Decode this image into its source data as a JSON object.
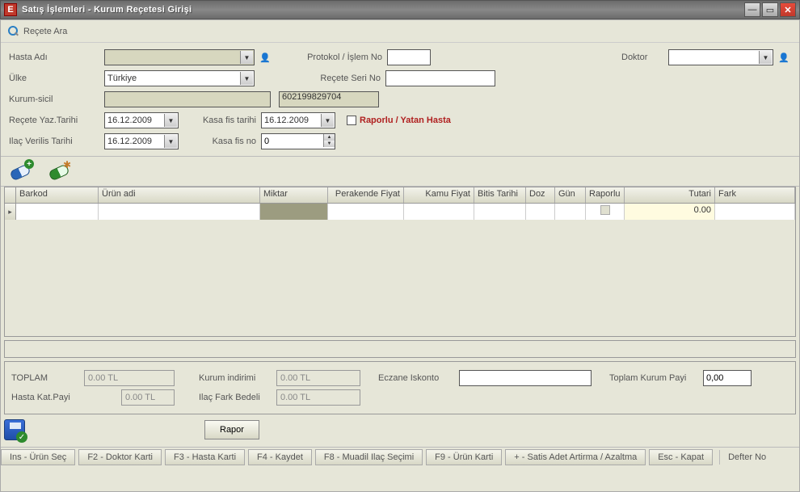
{
  "window": {
    "app_icon_letter": "E",
    "title": "Satış İşlemleri  -  Kurum Reçetesi Girişi"
  },
  "toolbar": {
    "search_label": "Reçete Ara"
  },
  "labels": {
    "hasta_adi": "Hasta Adı",
    "ulke": "Ülke",
    "kurum_sicil": "Kurum-sicil",
    "recete_yaz_tarihi": "Reçete Yaz.Tarihi",
    "ilac_verilis_tarihi": "Ilaç Verilis Tarihi",
    "kasa_fis_tarihi": "Kasa fis tarihi",
    "kasa_fis_no": "Kasa fis no",
    "protokol_islem_no": "Protokol / İşlem No",
    "recete_seri_no": "Reçete Seri No",
    "doktor": "Doktor",
    "raporlu_yatan": "Raporlu / Yatan Hasta"
  },
  "form": {
    "hasta_adi": "",
    "ulke": "Türkiye",
    "kurum_sicil_1": "",
    "kurum_sicil_2": "602199829704",
    "recete_yaz_tarihi": "16.12.2009",
    "kasa_fis_tarihi": "16.12.2009",
    "ilac_verilis_tarihi": "16.12.2009",
    "kasa_fis_no": "0",
    "protokol_islem_no": "",
    "recete_seri_no": "",
    "doktor": ""
  },
  "table": {
    "headers": [
      "Barkod",
      "Ürün adi",
      "Miktar",
      "Perakende Fiyat",
      "Kamu Fiyat",
      "Bitis Tarihi",
      "Doz",
      "Gün",
      "Raporlu",
      "Tutari",
      "Fark"
    ],
    "row": {
      "tutari": "0.00"
    }
  },
  "totals": {
    "toplam_label": "TOPLAM",
    "toplam_value": "0.00 TL",
    "kurum_indirimi_label": "Kurum indirimi",
    "kurum_indirimi_value": "0.00 TL",
    "eczane_iskonto_label": "Eczane Iskonto",
    "eczane_iskonto_value": "",
    "toplam_kurum_payi_label": "Toplam Kurum Payi",
    "toplam_kurum_payi_value": "0,00",
    "hasta_kat_payi_label": "Hasta Kat.Payi",
    "hasta_kat_payi_value": "0.00 TL",
    "ilac_fark_bedeli_label": "Ilaç Fark Bedeli",
    "ilac_fark_bedeli_value": "0.00 TL"
  },
  "buttons": {
    "rapor": "Rapor"
  },
  "status": {
    "items": [
      "Ins - Ürün Seç",
      "F2 - Doktor Karti",
      "F3 - Hasta Karti",
      "F4 - Kaydet",
      "F8 - Muadil Ilaç Seçimi",
      "F9 - Ürün Karti",
      "+ - Satis Adet Artirma / Azaltma",
      "Esc - Kapat"
    ],
    "defter_no_label": "Defter No"
  }
}
